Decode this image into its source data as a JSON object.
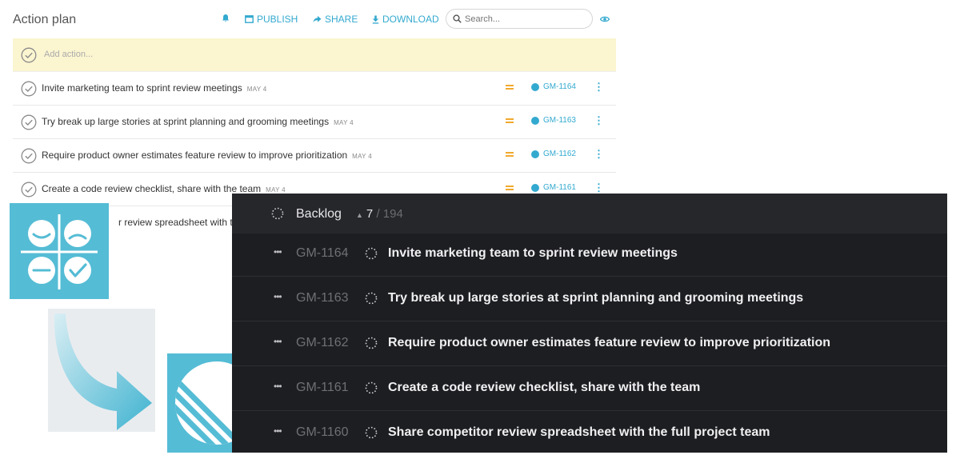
{
  "action_plan": {
    "title": "Action plan",
    "toolbar": {
      "bell_icon": "bell-icon",
      "publish_label": "PUBLISH",
      "share_label": "SHARE",
      "download_label": "DOWNLOAD"
    },
    "search": {
      "placeholder": "Search..."
    },
    "add_action": {
      "placeholder": "Add action..."
    },
    "items": [
      {
        "text": "Invite marketing team to sprint review meetings",
        "date": "MAY 4",
        "issue": "GM-1164"
      },
      {
        "text": "Try break up large stories at sprint planning and grooming meetings",
        "date": "MAY 4",
        "issue": "GM-1163"
      },
      {
        "text": "Require product owner estimates feature review to improve prioritization",
        "date": "MAY 4",
        "issue": "GM-1162"
      },
      {
        "text": "Create a code review checklist, share with the team",
        "date": "MAY 4",
        "issue": "GM-1161"
      },
      {
        "text": "r review spreadsheet with the",
        "date": "",
        "issue": ""
      }
    ],
    "colors": {
      "accent": "#33a9cf",
      "add_row_bg": "#fbf5d0",
      "priority": "#f2a92c"
    }
  },
  "backlog": {
    "title": "Backlog",
    "count": "7",
    "total": "/ 194",
    "items": [
      {
        "id": "GM-1164",
        "title": "Invite marketing team to sprint review meetings"
      },
      {
        "id": "GM-1163",
        "title": "Try break up large stories at sprint planning and grooming meetings"
      },
      {
        "id": "GM-1162",
        "title": "Require product owner estimates feature review to improve prioritization"
      },
      {
        "id": "GM-1161",
        "title": "Create a code review checklist, share with the team"
      },
      {
        "id": "GM-1160",
        "title": "Share competitor review spreadsheet with the full project team"
      }
    ],
    "colors": {
      "background": "#1d1e21",
      "header": "#26272b"
    }
  },
  "logos": {
    "retro_logo": "retrospective-grid-logo",
    "arrow": "curved-arrow-icon",
    "linear_logo": "linear-logo",
    "brand_color": "#55bcd5"
  }
}
